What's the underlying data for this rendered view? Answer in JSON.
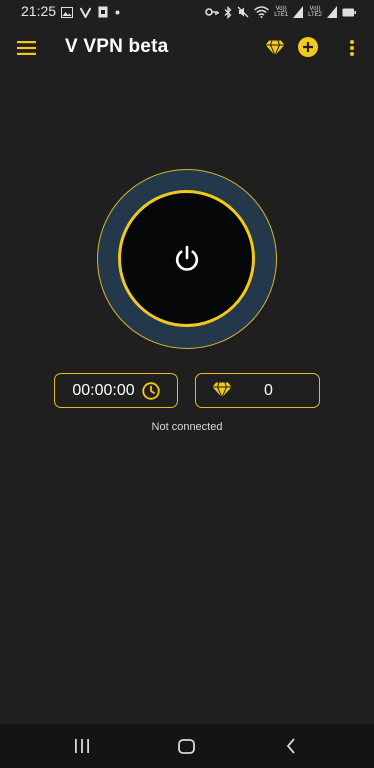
{
  "status_bar": {
    "time": "21:25",
    "carrier1_top": "Vo))",
    "carrier1_bottom": "LTE1",
    "carrier2_top": "Vo))",
    "carrier2_bottom": "LTE2"
  },
  "app_bar": {
    "title": "V VPN beta",
    "icons": [
      "menu-icon",
      "diamond-icon",
      "add-circle-icon",
      "more-vert-icon"
    ]
  },
  "connect": {
    "icon": "power-icon"
  },
  "stats": {
    "timer": "00:00:00",
    "timer_icon": "clock-icon",
    "gems": "0",
    "gems_icon": "diamond-icon"
  },
  "connection_status": "Not connected",
  "nav_bar": {
    "icons": [
      "recent-apps-icon",
      "home-icon",
      "back-icon"
    ]
  },
  "colors": {
    "background": "#1f1f1f",
    "accent": "#f2c91a",
    "ring": "#23384b",
    "nav_bar": "#141414"
  }
}
